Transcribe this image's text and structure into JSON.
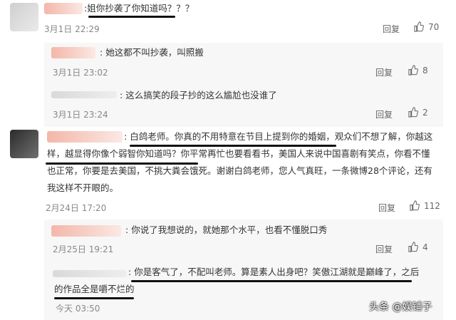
{
  "comments": [
    {
      "name": "",
      "text": "姐你抄袭了你知道吗？？？",
      "time": "3月1日 22:29",
      "reply_label": "回复",
      "likes": "70",
      "replies": [
        {
          "name": "",
          "text": "她这都不叫抄袭，叫照搬",
          "time": "3月1日 23:02",
          "reply_label": "回复",
          "likes": "8"
        },
        {
          "name": "",
          "text": "这么搞笑的段子抄的这么尴尬也没谁了",
          "time": "3月1日 23:24",
          "reply_label": "回复",
          "likes": "2"
        }
      ]
    },
    {
      "name": "",
      "text_lines": [
        "白鸽老师。你真的不用特意在节目上提到你的婚姻，观众们不想了解，你越这",
        "样，越显得你像个弱智你知道吗？你平常再忙也要看看书，美国人来说中国喜剧有笑点，你看不懂",
        "也正常，你要是去美国，不挑大粪会饿死。谢谢白鸽老师，您人气真旺，一条微博28个评论，还有",
        "我这样不开眼的。"
      ],
      "time": "2月24日 17:20",
      "reply_label": "回复",
      "likes": "112",
      "replies": [
        {
          "name": "",
          "text": "你说了我想说的，就她那个水平，也看不懂脱口秀",
          "time": "2月25日 19:21",
          "reply_label": "回复",
          "likes": "4"
        },
        {
          "name": "",
          "text_lines": [
            "你是客气了，不配叫老师。算是素人出身吧？笑傲江湖就是巅峰了，之后",
            "的作品全是嚼不烂的"
          ],
          "time": "今天 03:50"
        }
      ]
    }
  ],
  "watermark": "头条 @娱铺子",
  "colors": {
    "accent": "#e6633b",
    "underline": "#111111",
    "reply_bg": "#f7f7f7"
  },
  "icons": [
    "thumbs-up-icon"
  ]
}
